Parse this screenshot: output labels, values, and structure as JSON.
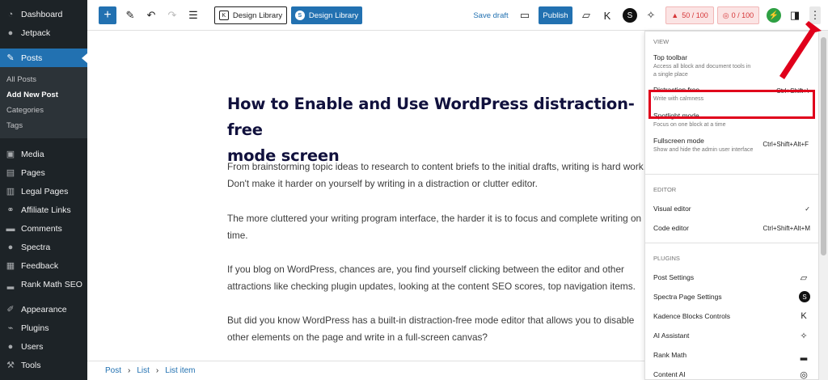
{
  "sidebar": {
    "top_items": [
      {
        "label": "Dashboard",
        "icon": "dashboard-icon"
      },
      {
        "label": "Jetpack",
        "icon": "jetpack-icon"
      }
    ],
    "posts": {
      "label": "Posts",
      "icon": "pin-icon"
    },
    "posts_sub": [
      "All Posts",
      "Add New Post",
      "Categories",
      "Tags"
    ],
    "items": [
      {
        "label": "Media",
        "icon": "media-icon"
      },
      {
        "label": "Pages",
        "icon": "pages-icon"
      },
      {
        "label": "Legal Pages",
        "icon": "legal-icon"
      },
      {
        "label": "Affiliate Links",
        "icon": "link-icon"
      },
      {
        "label": "Comments",
        "icon": "comment-icon"
      },
      {
        "label": "Spectra",
        "icon": "spectra-icon"
      },
      {
        "label": "Feedback",
        "icon": "feedback-icon"
      },
      {
        "label": "Rank Math SEO",
        "icon": "rankmath-icon"
      },
      {
        "label": "Appearance",
        "icon": "brush-icon"
      },
      {
        "label": "Plugins",
        "icon": "plug-icon"
      },
      {
        "label": "Users",
        "icon": "users-icon"
      },
      {
        "label": "Tools",
        "icon": "tools-icon"
      }
    ]
  },
  "toolbar": {
    "design_library_1": "Design Library",
    "design_library_2": "Design Library",
    "save_draft": "Save draft",
    "publish": "Publish",
    "seo_score": "50 / 100",
    "readability_score": "0 / 100"
  },
  "post": {
    "title_line1": "How to Enable and Use WordPress distraction-free",
    "title_line2": "mode screen",
    "paragraphs": [
      [
        "From brainstorming topic ideas to research to content briefs to the initial drafts, writing is hard work.",
        "Don't make it harder on yourself by writing in a distraction or clutter editor."
      ],
      [
        "The more cluttered your writing program interface, the harder it is to focus and complete writing on",
        "time."
      ],
      [
        "If you blog on WordPress, chances are, you find yourself clicking between the editor and other",
        "attractions like checking plugin updates, looking at the content SEO scores, top navigation items."
      ],
      [
        "But did you know WordPress has a built-in distraction-free mode editor that allows you to disable",
        "other elements on the page and write in a full-screen canvas?"
      ]
    ]
  },
  "breadcrumb": [
    "Post",
    "List",
    "List item"
  ],
  "menu": {
    "view_heading": "VIEW",
    "top_toolbar": {
      "label": "Top toolbar",
      "desc": "Access all block and document tools in a single place"
    },
    "distraction_free": {
      "label": "Distraction free",
      "desc": "Write with calmness",
      "shortcut": "Ctrl+Shift+\\"
    },
    "spotlight": {
      "label": "Spotlight mode",
      "desc": "Focus on one block at a time"
    },
    "fullscreen": {
      "label": "Fullscreen mode",
      "desc": "Show and hide the admin user interface",
      "shortcut": "Ctrl+Shift+Alt+F"
    },
    "editor_heading": "EDITOR",
    "visual_editor": {
      "label": "Visual editor",
      "check": "✓"
    },
    "code_editor": {
      "label": "Code editor",
      "shortcut": "Ctrl+Shift+Alt+M"
    },
    "plugins_heading": "PLUGINS",
    "plugins": [
      {
        "label": "Post Settings",
        "icon": "post-settings-icon"
      },
      {
        "label": "Spectra Page Settings",
        "icon": "spectra-icon"
      },
      {
        "label": "Kadence Blocks Controls",
        "icon": "kadence-icon"
      },
      {
        "label": "AI Assistant",
        "icon": "sparkle-icon"
      },
      {
        "label": "Rank Math",
        "icon": "rankmath-icon"
      },
      {
        "label": "Content AI",
        "icon": "content-ai-icon"
      }
    ]
  },
  "colors": {
    "accent": "#2271b1",
    "sidebar": "#1d2327",
    "highlight": "#e0001b"
  }
}
